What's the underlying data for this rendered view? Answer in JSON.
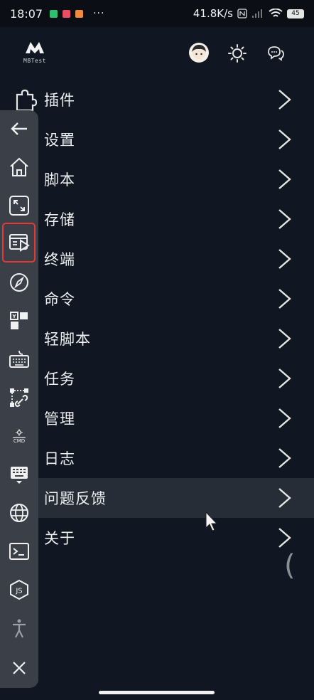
{
  "status_bar": {
    "time": "18:07",
    "dots": "···",
    "speed": "41.8K/s",
    "battery": "45"
  },
  "header": {
    "logo_text": "MBTest",
    "icons": [
      "avatar",
      "theme-toggle-icon",
      "chat-icon"
    ]
  },
  "menu": {
    "items": [
      {
        "label": "插件"
      },
      {
        "label": "设置"
      },
      {
        "label": "脚本"
      },
      {
        "label": "存储"
      },
      {
        "label": "终端"
      },
      {
        "label": "命令"
      },
      {
        "label": "轻脚本"
      },
      {
        "label": "任务"
      },
      {
        "label": "管理"
      },
      {
        "label": "日志"
      },
      {
        "label": "问题反馈"
      },
      {
        "label": "关于"
      }
    ],
    "active_index": 10
  },
  "sidebar": {
    "tools": [
      "back-arrow-icon",
      "home-icon",
      "fullscreen-icon",
      "play-window-icon",
      "compass-icon",
      "layout-icon",
      "keyboard-icon",
      "flow-link-icon",
      "cmd-icon",
      "input-keyboard-icon",
      "globe-icon",
      "terminal-icon",
      "js-icon",
      "accessibility-icon",
      "close-icon"
    ],
    "cmd_label": "CMD",
    "js_label": "JS"
  },
  "misc": {
    "paren": "("
  },
  "colors": {
    "background": "#101722",
    "sidebar": "#3a3f48",
    "highlight": "#e53935",
    "active_row": "#262d36"
  }
}
